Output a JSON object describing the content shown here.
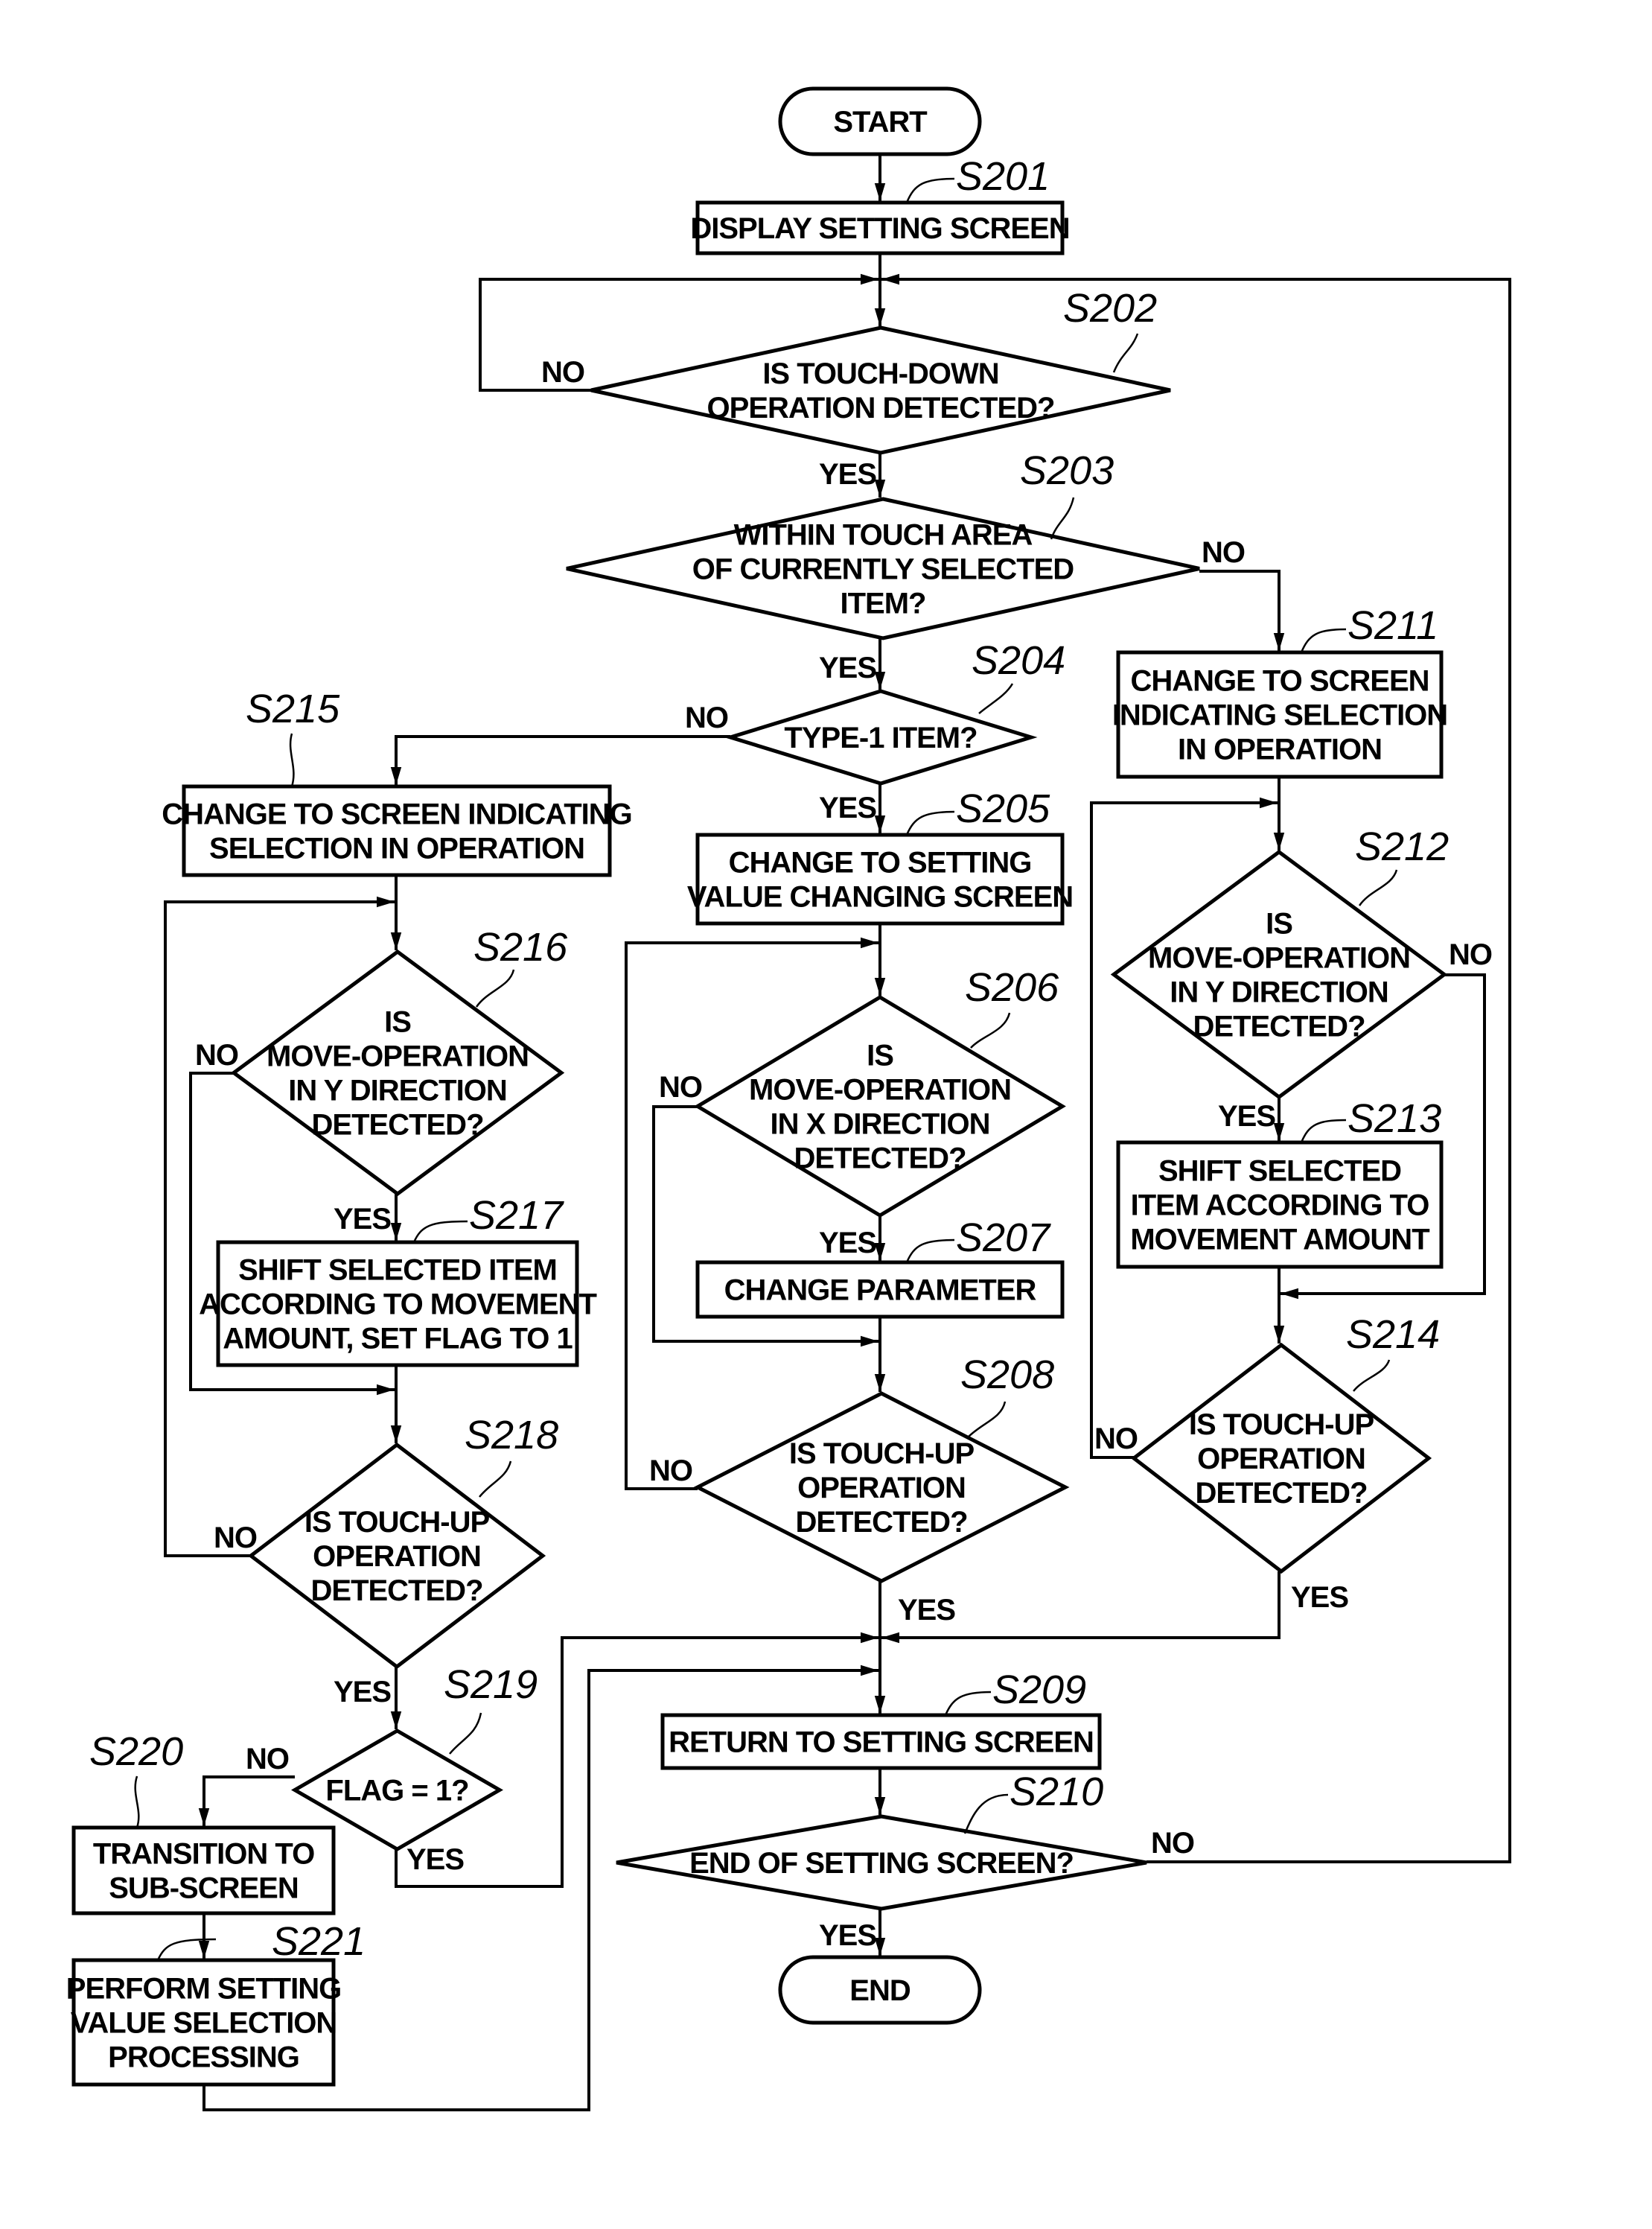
{
  "figure": {
    "terminals": {
      "start": "START",
      "end": "END"
    },
    "steps": {
      "S201": {
        "label": "S201",
        "lines": [
          "DISPLAY SETTING SCREEN"
        ]
      },
      "S202": {
        "label": "S202",
        "lines": [
          "IS TOUCH-DOWN",
          "OPERATION DETECTED?"
        ]
      },
      "S203": {
        "label": "S203",
        "lines": [
          "WITHIN TOUCH AREA",
          "OF CURRENTLY SELECTED",
          "ITEM?"
        ]
      },
      "S204": {
        "label": "S204",
        "lines": [
          "TYPE-1 ITEM?"
        ]
      },
      "S205": {
        "label": "S205",
        "lines": [
          "CHANGE TO SETTING",
          "VALUE CHANGING SCREEN"
        ]
      },
      "S206": {
        "label": "S206",
        "lines": [
          "IS",
          "MOVE-OPERATION",
          "IN X DIRECTION",
          "DETECTED?"
        ]
      },
      "S207": {
        "label": "S207",
        "lines": [
          "CHANGE PARAMETER"
        ]
      },
      "S208": {
        "label": "S208",
        "lines": [
          "IS TOUCH-UP",
          "OPERATION",
          "DETECTED?"
        ]
      },
      "S209": {
        "label": "S209",
        "lines": [
          "RETURN TO SETTING SCREEN"
        ]
      },
      "S210": {
        "label": "S210",
        "lines": [
          "END OF SETTING SCREEN?"
        ]
      },
      "S211": {
        "label": "S211",
        "lines": [
          "CHANGE TO SCREEN",
          "INDICATING SELECTION",
          "IN OPERATION"
        ]
      },
      "S212": {
        "label": "S212",
        "lines": [
          "IS",
          "MOVE-OPERATION",
          "IN Y DIRECTION",
          "DETECTED?"
        ]
      },
      "S213": {
        "label": "S213",
        "lines": [
          "SHIFT SELECTED",
          "ITEM ACCORDING TO",
          "MOVEMENT AMOUNT"
        ]
      },
      "S214": {
        "label": "S214",
        "lines": [
          "IS TOUCH-UP",
          "OPERATION",
          "DETECTED?"
        ]
      },
      "S215": {
        "label": "S215",
        "lines": [
          "CHANGE TO SCREEN INDICATING",
          "SELECTION IN OPERATION"
        ]
      },
      "S216": {
        "label": "S216",
        "lines": [
          "IS",
          "MOVE-OPERATION",
          "IN Y DIRECTION",
          "DETECTED?"
        ]
      },
      "S217": {
        "label": "S217",
        "lines": [
          "SHIFT SELECTED ITEM",
          "ACCORDING TO MOVEMENT",
          "AMOUNT, SET FLAG TO 1"
        ]
      },
      "S218": {
        "label": "S218",
        "lines": [
          "IS TOUCH-UP",
          "OPERATION",
          "DETECTED?"
        ]
      },
      "S219": {
        "label": "S219",
        "lines": [
          "FLAG = 1?"
        ]
      },
      "S220": {
        "label": "S220",
        "lines": [
          "TRANSITION TO",
          "SUB-SCREEN"
        ]
      },
      "S221": {
        "label": "S221",
        "lines": [
          "PERFORM SETTING",
          "VALUE SELECTION",
          "PROCESSING"
        ]
      }
    },
    "branches": {
      "yes": "YES",
      "no": "NO"
    }
  }
}
